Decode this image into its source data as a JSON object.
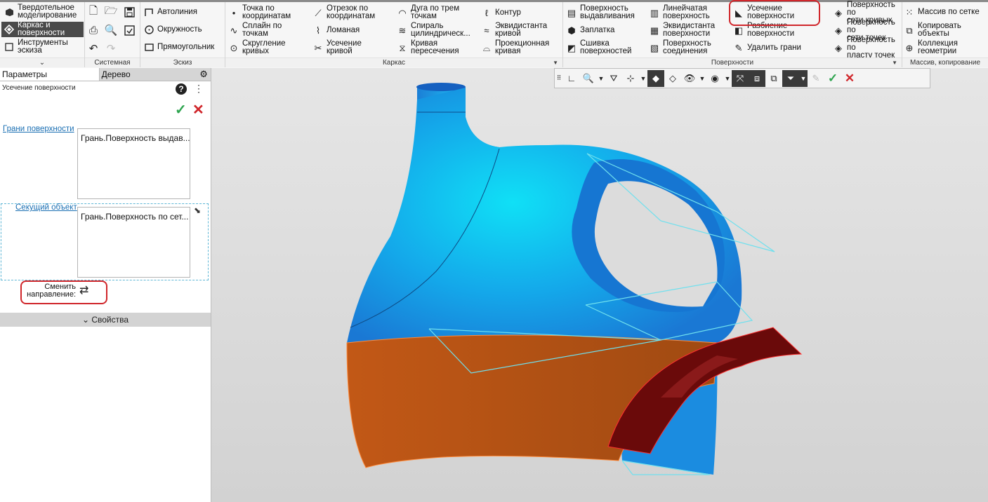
{
  "modes": [
    {
      "label": "Твердотельное\nмоделирование",
      "icon": "solid-modeling-icon"
    },
    {
      "label": "Каркас и\nповерхности",
      "icon": "wireframe-surfaces-icon"
    },
    {
      "label": "Инструменты\nэскиза",
      "icon": "sketch-tools-icon"
    }
  ],
  "groups": {
    "system": "Системная",
    "sketch": "Эскиз",
    "wireframe": "Каркас",
    "surfaces": "Поверхности",
    "arrays": "Массив, копирование"
  },
  "sketch_buttons": [
    "Автолиния",
    "Окружность",
    "Прямоугольник"
  ],
  "wireframe_buttons": [
    "Точка по\nкоординатам",
    "Отрезок по\nкоординатам",
    "Дуга по трем\nточкам",
    "Контур",
    "Сплайн по\nточкам",
    "Ломаная",
    "Спираль\nцилиндрическ...",
    "Эквидистанта\nкривой",
    "Скругление\nкривых",
    "Усечение\nкривой",
    "Кривая\nпересечения",
    "Проекционная\nкривая"
  ],
  "surface_buttons": [
    "Поверхность\nвыдавливания",
    "Линейчатая\nповерхность",
    "Усечение\nповерхности",
    "Поверхность по\nсети кривых",
    "Заплатка",
    "Эквидистанта\nповерхности",
    "Разбиение\nповерхности",
    "Поверхность по\nсети точек",
    "Сшивка\nповерхностей",
    "Поверхность\nсоединения",
    "Удалить грани",
    "Поверхность по\nпласту точек"
  ],
  "array_buttons": [
    "Массив по сетке",
    "Копировать\nобъекты",
    "Коллекция\nгеометрии"
  ],
  "panel": {
    "tab_params": "Параметры",
    "tab_tree": "Дерево",
    "title": "Усечение поверхности",
    "faces_label": "Грани поверхности",
    "faces_value": "Грань.Поверхность выдав...",
    "cutting_label": "Секущий объект",
    "cutting_value": "Грань.Поверхность по сет...",
    "change_direction": "Сменить\nнаправление:",
    "properties": "Свойства"
  },
  "colors": {
    "accent_red": "#d0262b",
    "body_blue": "#18a0e8",
    "cut_orange": "#c05a14",
    "cutter_dark": "#6a0a0a",
    "cyan_outline": "#6fe0ee"
  }
}
